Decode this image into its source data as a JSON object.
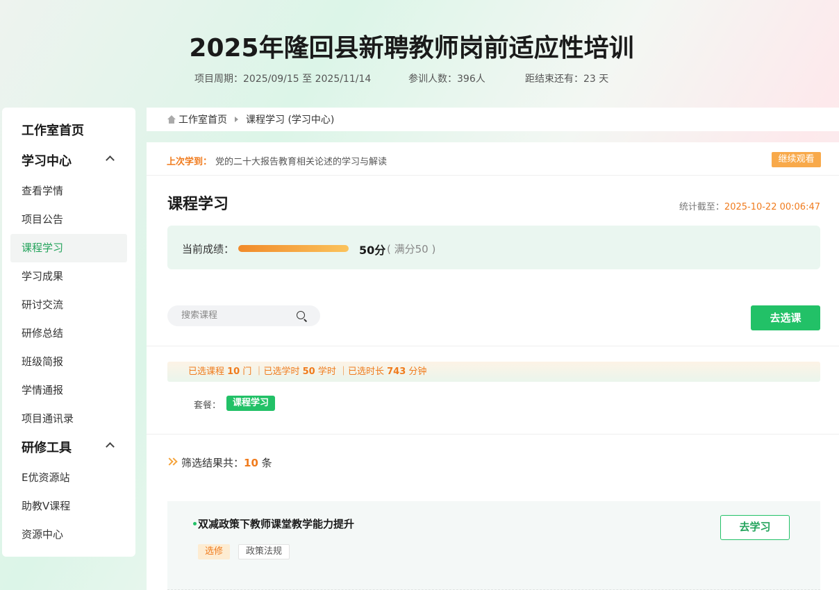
{
  "project": {
    "title": "2025年隆回县新聘教师岗前适应性培训",
    "period": "项目周期：2025/09/15 至 2025/11/14",
    "participants": "参训人数：396人",
    "remaining": "距结束还有：23 天"
  },
  "sidebar": {
    "home": "工作室首页",
    "learning_center": "学习中心",
    "learning_items": [
      "查看学情",
      "项目公告",
      "课程学习",
      "学习成果",
      "研讨交流",
      "研修总结",
      "班级简报",
      "学情通报",
      "项目通讯录"
    ],
    "active_item": "课程学习",
    "tools": "研修工具",
    "tool_items": [
      "E优资源站",
      "助教V课程",
      "资源中心"
    ]
  },
  "breadcrumb": {
    "home": "工作室首页",
    "current": "课程学习 (学习中心)"
  },
  "last_learned": {
    "label": "上次学到：",
    "course": "党的二十大报告教育相关论述的学习与解读",
    "button": "继续观看"
  },
  "course_study": {
    "title": "课程学习",
    "stats_label": "统计截至：",
    "stats_time": "2025-10-22 00:06:47",
    "score_label": "当前成绩：",
    "score_progress": 1.0,
    "score_value": "50分",
    "score_full": "( 满分50 )"
  },
  "search": {
    "placeholder": "搜索课程"
  },
  "choose_button": "去选课",
  "selection": {
    "p1": "已选课程 ",
    "courses": "10",
    "p2": " 门 ｜已选学时 ",
    "hours": "50",
    "p3": " 学时 ｜已选时长 ",
    "minutes": "743",
    "p4": " 分钟"
  },
  "package": {
    "label": "套餐：",
    "tag": "课程学习"
  },
  "filter": {
    "prefix": "筛选结果共：",
    "count": "10",
    "suffix": " 条"
  },
  "courses": [
    {
      "title": "双减政策下教师课堂教学能力提升",
      "type": "选修",
      "category": "政策法规",
      "button": "去学习"
    }
  ],
  "colors": {
    "accent_green": "#22c167",
    "accent_orange": "#f07b1d"
  }
}
